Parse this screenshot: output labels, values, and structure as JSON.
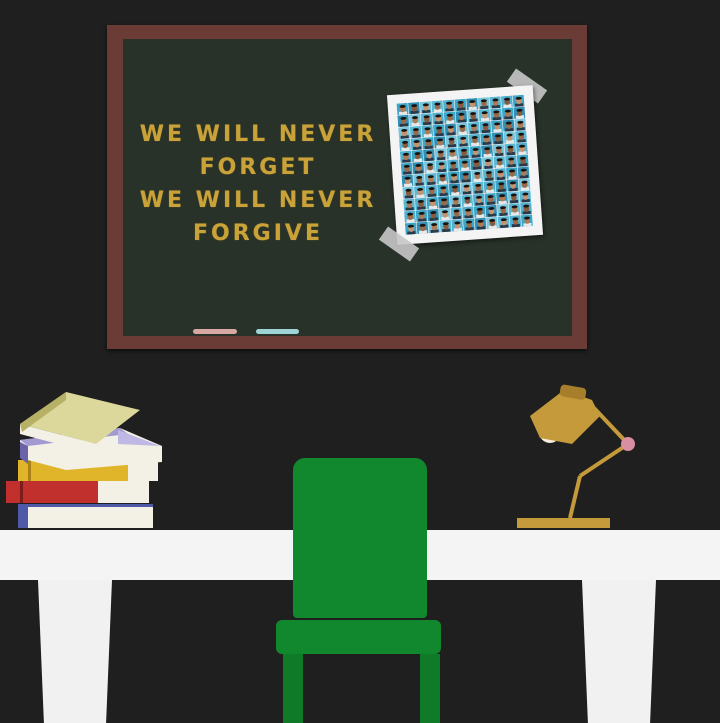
{
  "board": {
    "lines": [
      "WE WILL NEVER",
      "FORGET",
      "WE WILL NEVER",
      "FORGIVE"
    ]
  },
  "colors": {
    "background": "#1f1f1f",
    "board": "#283229",
    "frame": "#6b3b36",
    "text": "#c9a23a",
    "chair": "#12882e",
    "desk": "#f4f4f4"
  },
  "icons": {
    "collage": "photo-collage-icon",
    "books": "book-stack-icon",
    "lamp": "desk-lamp-icon",
    "chair": "chair-icon"
  }
}
